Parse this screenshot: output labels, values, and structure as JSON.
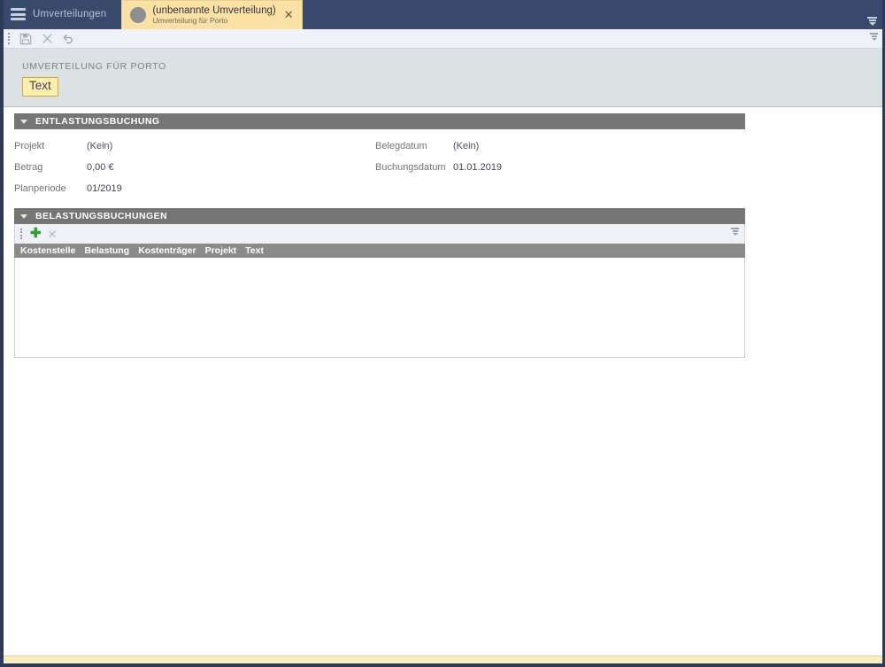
{
  "titlebar": {
    "menu_icon": "hamburger-icon",
    "brand": "Umverteilungen",
    "overflow_icon": "overflow-chevron-icon",
    "tab": {
      "avatar_icon": "record-avatar-icon",
      "title": "(unbenannte Umverteilung)",
      "subtitle": "Umverteilung für Porto",
      "close_label": "✕"
    }
  },
  "toolbar": {
    "grip_icon": "drag-grip-icon",
    "save_icon": "save-floppy-icon",
    "cancel_icon": "cancel-x-icon",
    "undo_icon": "undo-arrow-icon",
    "overflow_icon": "overflow-chevron-icon"
  },
  "document_header": {
    "caption": "UMVERTEILUNG FÜR PORTO",
    "text_field_value": "Text",
    "text_field_placeholder": "Text",
    "field_border_color": "#d4a63d",
    "field_background_color": "#fdeeb0"
  },
  "sections": {
    "entlastungsbuchung": {
      "collapse_icon": "chevron-down-icon",
      "title": "ENTLASTUNGSBUCHUNG",
      "fields_left": [
        {
          "label": "Projekt",
          "value": "(Kein)"
        },
        {
          "label": "Betrag",
          "value": "0,00 €"
        },
        {
          "label": "Planperiode",
          "value": "01/2019"
        }
      ],
      "fields_right": [
        {
          "label": "Belegdatum",
          "value": "(Kein)"
        },
        {
          "label": "Buchungsdatum",
          "value": "01.01.2019"
        }
      ]
    },
    "belastungsbuchungen": {
      "collapse_icon": "chevron-down-icon",
      "title": "BELASTUNGSBUCHUNGEN",
      "toolbar": {
        "grip_icon": "drag-grip-icon",
        "add_label": "✚",
        "delete_label": "✕",
        "overflow_icon": "overflow-chevron-icon"
      },
      "columns": [
        "Kostenstelle",
        "Belastung",
        "Kostenträger",
        "Projekt",
        "Text"
      ],
      "rows": []
    }
  },
  "theme": {
    "titlebar_background": "#374a6b",
    "window_border": "#2d3b59",
    "tab_background": "#fbe2a4",
    "section_header_background": "#757575",
    "grid_header_background": "#8b8b8b",
    "document_header_background": "#dce2e4",
    "toolbar_background": "#eef2f8",
    "accent_gold": "#faecc0",
    "add_icon_color": "#3a9a3a"
  }
}
